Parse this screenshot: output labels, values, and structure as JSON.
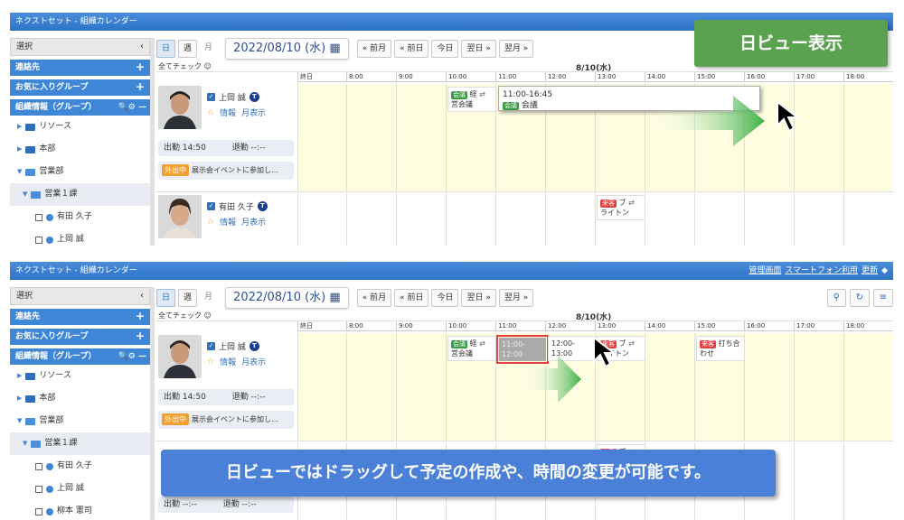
{
  "captions": {
    "top": "日ビュー表示",
    "bottom": "日ビューではドラッグして予定の作成や、時間の変更が可能です。"
  },
  "app": {
    "title": "ネクストセット - 組織カレンダー",
    "header_links": [
      "管理画面",
      "スマートフォン利用",
      "更新"
    ]
  },
  "sidebar": {
    "select_label": "選択",
    "contacts": "連絡先",
    "favorites": "お気に入りグループ",
    "org": "組織情報（グループ）",
    "tree": [
      "リソース",
      "本部",
      "営業部",
      "営業１課",
      "有田 久子",
      "上岡 誠",
      "柳本 憲司"
    ]
  },
  "toolbar": {
    "view_day": "日",
    "view_week": "週",
    "view_month": "月",
    "date": "2022/08/10 (水)",
    "prev_month": "« 前月",
    "prev_day": "« 前日",
    "today": "今日",
    "next_day": "翌日 »",
    "next_month": "翌月 »"
  },
  "grid": {
    "check_all": "全てチェック",
    "date_header": "8/10(水)",
    "hours": [
      "終日",
      "8:00",
      "9:00",
      "10:00",
      "11:00",
      "12:00",
      "13:00",
      "14:00",
      "15:00",
      "16:00",
      "17:00",
      "18:00"
    ]
  },
  "users": [
    {
      "name": "上岡 誠",
      "badge": "T",
      "info": "情報",
      "month": "月表示",
      "attend": "出勤 14:50",
      "leave": "退勤 --:--",
      "out_badge": "外出中",
      "out_text": "展示会イベントに参加し…"
    },
    {
      "name": "有田 久子",
      "badge": "T",
      "info": "情報",
      "month": "月表示",
      "attend": "出勤 --:--",
      "leave": "退勤 --:--"
    }
  ],
  "events": {
    "meeting_tag": "会議",
    "meeting_title_1": "経",
    "meeting_title_2": "営会議",
    "popup_time": "11:00-16:45",
    "popup_title": "会議",
    "visit_tag": "来客",
    "visit_title_1": "ブ",
    "visit_title_2": "ライトン",
    "drag_time_1": "11:00-",
    "drag_time_2": "12:00",
    "moved_time_1": "12:00-",
    "moved_time_2": "13:00",
    "meet2_title_1": "打ち合",
    "meet2_title_2": "わせ"
  }
}
